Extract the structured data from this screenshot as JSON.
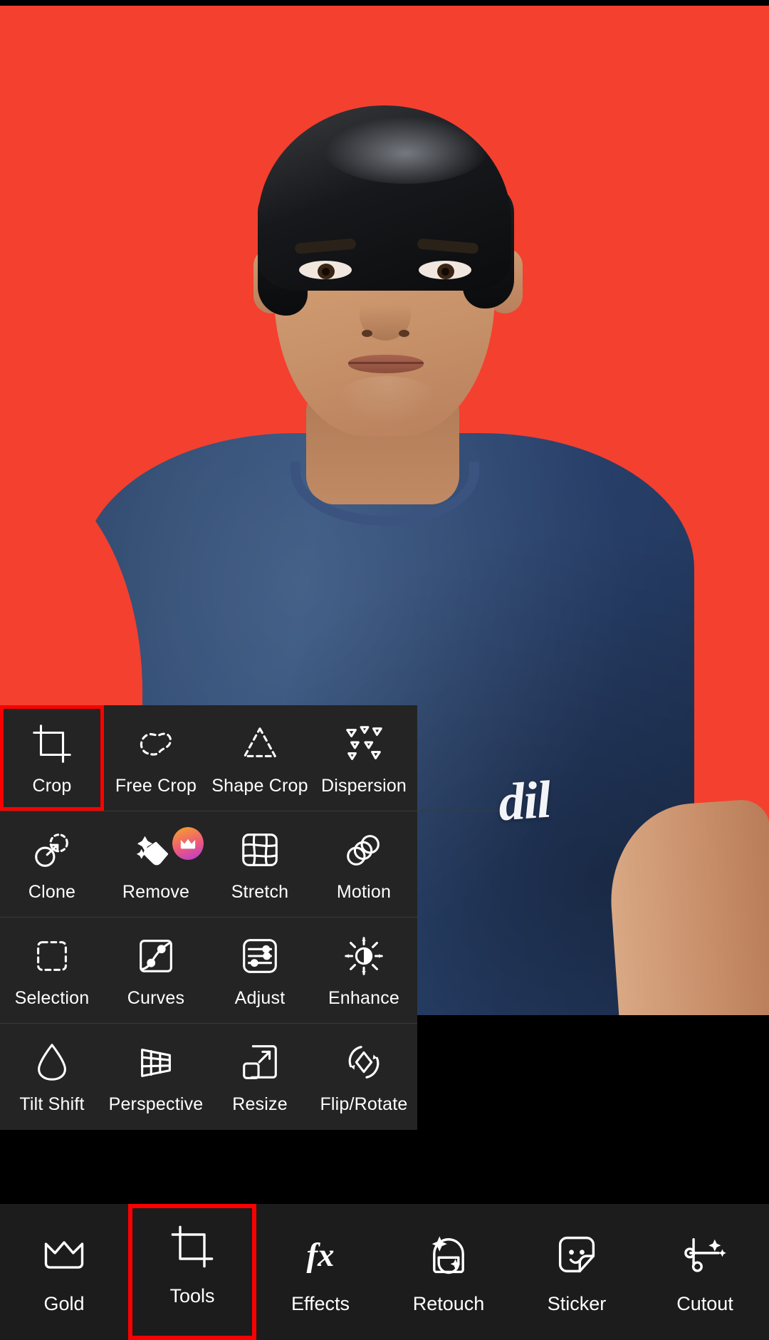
{
  "app": {
    "accent_red": "#fb0000",
    "photo_background": "#f4402f",
    "panel_background": "#242424",
    "nav_background": "#1c1c1c"
  },
  "photo": {
    "shirt_text": "dil",
    "subject_alt": "Portrait of a young man in a navy t-shirt on a red background"
  },
  "tools_panel": {
    "rows": [
      {
        "items": [
          {
            "label": "Crop",
            "icon": "crop-icon",
            "selected": true,
            "pro": false
          },
          {
            "label": "Free Crop",
            "icon": "free-crop-icon",
            "selected": false,
            "pro": false
          },
          {
            "label": "Shape Crop",
            "icon": "shape-crop-icon",
            "selected": false,
            "pro": false
          },
          {
            "label": "Dispersion",
            "icon": "dispersion-icon",
            "selected": false,
            "pro": false
          }
        ]
      },
      {
        "items": [
          {
            "label": "Clone",
            "icon": "clone-icon",
            "selected": false,
            "pro": false
          },
          {
            "label": "Remove",
            "icon": "remove-icon",
            "selected": false,
            "pro": true
          },
          {
            "label": "Stretch",
            "icon": "stretch-icon",
            "selected": false,
            "pro": false
          },
          {
            "label": "Motion",
            "icon": "motion-icon",
            "selected": false,
            "pro": false
          }
        ]
      },
      {
        "items": [
          {
            "label": "Selection",
            "icon": "selection-icon",
            "selected": false,
            "pro": false
          },
          {
            "label": "Curves",
            "icon": "curves-icon",
            "selected": false,
            "pro": false
          },
          {
            "label": "Adjust",
            "icon": "adjust-icon",
            "selected": false,
            "pro": false
          },
          {
            "label": "Enhance",
            "icon": "enhance-icon",
            "selected": false,
            "pro": false
          }
        ]
      },
      {
        "items": [
          {
            "label": "Tilt Shift",
            "icon": "tilt-shift-icon",
            "selected": false,
            "pro": false
          },
          {
            "label": "Perspective",
            "icon": "perspective-icon",
            "selected": false,
            "pro": false
          },
          {
            "label": "Resize",
            "icon": "resize-icon",
            "selected": false,
            "pro": false
          },
          {
            "label": "Flip/Rotate",
            "icon": "flip-rotate-icon",
            "selected": false,
            "pro": false
          }
        ]
      }
    ]
  },
  "bottom_nav": {
    "items": [
      {
        "label": "Gold",
        "icon": "crown-icon",
        "selected": false
      },
      {
        "label": "Tools",
        "icon": "crop-icon",
        "selected": true
      },
      {
        "label": "Effects",
        "icon": "fx-icon",
        "selected": false
      },
      {
        "label": "Retouch",
        "icon": "retouch-icon",
        "selected": false
      },
      {
        "label": "Sticker",
        "icon": "sticker-icon",
        "selected": false
      },
      {
        "label": "Cutout",
        "icon": "cutout-icon",
        "selected": false
      }
    ]
  }
}
